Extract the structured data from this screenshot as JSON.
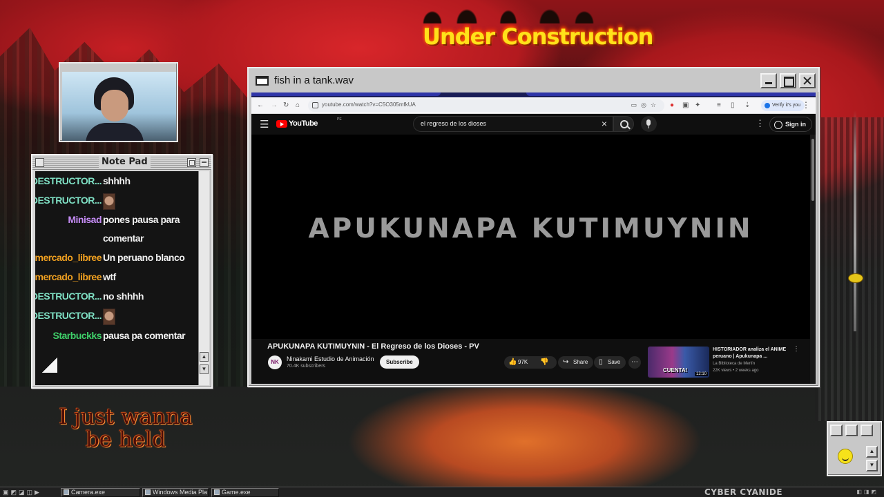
{
  "desktop": {
    "banner": "Under Construction",
    "held_text_line1": "I just wanna",
    "held_text_line2": "be held",
    "brand": "CYBER CYANIDE"
  },
  "camera_window": {
    "title": "Camera.exe"
  },
  "notepad": {
    "title": "Note Pad",
    "messages": [
      {
        "user": "DESTRUCTOR...",
        "user_color": "#7fe0c4",
        "text": "shhhh"
      },
      {
        "user": "DESTRUCTOR...",
        "user_color": "#7fe0c4",
        "emote": "face-emote"
      },
      {
        "user": "Minisad",
        "user_color": "#c58cf5",
        "text": "pones pausa para"
      },
      {
        "user": "",
        "user_color": "#c58cf5",
        "text": "comentar"
      },
      {
        "user": "mercado_libree",
        "user_color": "#f0a020",
        "text": "Un peruano blanco"
      },
      {
        "user": "mercado_libree",
        "user_color": "#f0a020",
        "text": "wtf"
      },
      {
        "user": "DESTRUCTOR...",
        "user_color": "#7fe0c4",
        "text": "no shhhh"
      },
      {
        "user": "DESTRUCTOR...",
        "user_color": "#7fe0c4",
        "emote": "face-emote"
      },
      {
        "user": "Starbuckks",
        "user_color": "#3fd06a",
        "text": "pausa pa comentar"
      }
    ]
  },
  "browser_window": {
    "title": "fish in a tank.wav",
    "url": "youtube.com/watch?v=C5O305mfkUA",
    "verify_label": "Verify it's you",
    "youtube": {
      "logo": "YouTube",
      "region": "PE",
      "search_value": "el regreso de los dioses",
      "sign_in": "Sign in",
      "player_text": "APUKUNAPA KUTIMUYNIN",
      "video_title": "APUKUNAPA KUTIMUYNIN - El Regreso de los Dioses - PV",
      "channel_initials": "NK",
      "channel_name": "Ninakami Estudio de Animación",
      "channel_subs": "70.4K subscribers",
      "subscribe_label": "Subscribe",
      "likes": "97K",
      "share_label": "Share",
      "save_label": "Save",
      "recommended": {
        "title": "HISTORIADOR analiza el ANIME peruano | Apukunapa ...",
        "channel": "La Biblioteca de Merlín",
        "meta": "22K views • 2 weeks ago",
        "duration": "12:10",
        "thumb_text": "CUENTA!"
      }
    }
  },
  "taskbar": {
    "tasks": [
      {
        "label": "Camera.exe"
      },
      {
        "label": "Windows Media Pla"
      },
      {
        "label": "Game.exe"
      }
    ]
  }
}
